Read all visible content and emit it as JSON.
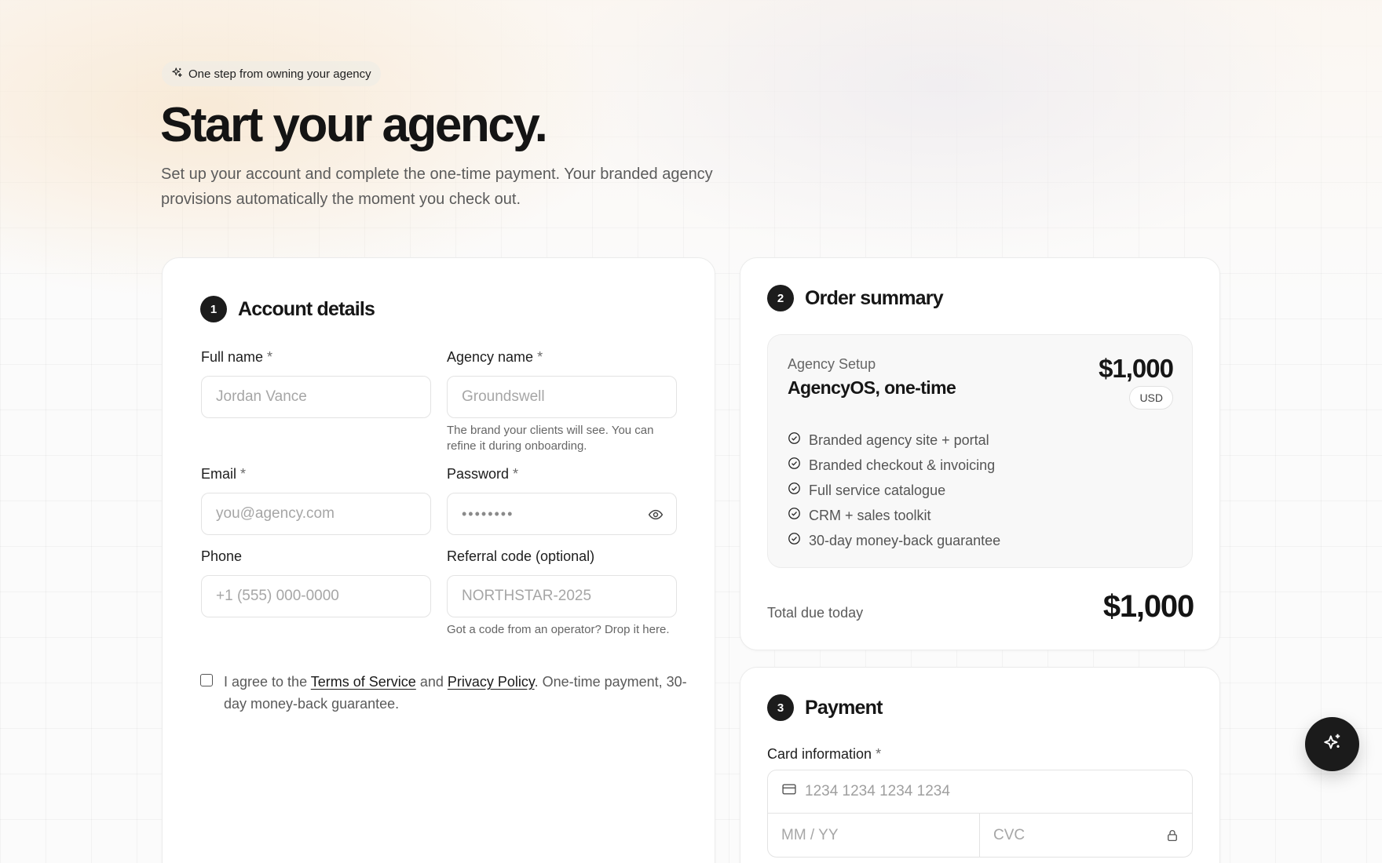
{
  "hero": {
    "pill_text": "One step from owning your agency",
    "title": "Start your agency.",
    "subtitle": "Set up your account and complete the one-time payment. Your branded agency provisions automatically the moment you check out."
  },
  "account": {
    "step": "1",
    "title": "Account details",
    "full_name": {
      "label": "Full name",
      "required": "*",
      "placeholder": "Jordan Vance"
    },
    "agency_name": {
      "label": "Agency name",
      "required": "*",
      "placeholder": "Groundswell",
      "hint": "The brand your clients will see. You can refine it during onboarding."
    },
    "email": {
      "label": "Email",
      "required": "*",
      "placeholder": "you@agency.com"
    },
    "password": {
      "label": "Password",
      "required": "*",
      "value": "••••••••"
    },
    "phone": {
      "label": "Phone",
      "placeholder": "+1 (555) 000-0000"
    },
    "referral": {
      "label": "Referral code (optional)",
      "placeholder": "NORTHSTAR-2025",
      "hint": "Got a code from an operator? Drop it here."
    },
    "agree": {
      "prefix": "I agree to the ",
      "terms_link": "Terms of Service",
      "middle": " and ",
      "privacy_link": "Privacy Policy",
      "suffix": ". One-time payment, 30-day money-back guarantee."
    }
  },
  "order": {
    "step": "2",
    "title": "Order summary",
    "product_kicker": "Agency Setup",
    "product_name": "AgencyOS, one-time",
    "price": "$1,000",
    "currency": "USD",
    "features": [
      "Branded agency site + portal",
      "Branded checkout & invoicing",
      "Full service catalogue",
      "CRM + sales toolkit",
      "30-day money-back guarantee"
    ],
    "total_label": "Total due today",
    "total_value": "$1,000"
  },
  "payment": {
    "step": "3",
    "title": "Payment",
    "card_label": "Card information",
    "required": "*",
    "card_number_placeholder": "1234 1234 1234 1234",
    "expiry_placeholder": "MM / YY",
    "cvc_placeholder": "CVC"
  },
  "icons": {
    "pill": "sparkles-icon",
    "eye": "eye-icon",
    "feature": "check-circle-icon",
    "card": "credit-card-icon",
    "lock": "lock-icon",
    "fab": "sparkles-icon"
  }
}
